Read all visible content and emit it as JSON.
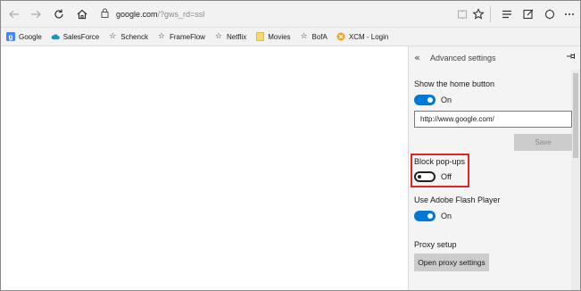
{
  "toolbar": {
    "back_icon": "arrow-left-icon",
    "forward_icon": "arrow-right-icon",
    "refresh_icon": "refresh-icon",
    "home_icon": "home-icon",
    "lock_icon": "lock-icon",
    "address_host": "google.com",
    "address_path": "/?gws_rd=ssl",
    "reading_view_icon": "book-icon",
    "favorite_icon": "star-icon",
    "hub_icon": "hub-icon",
    "note_icon": "pen-note-icon",
    "share_icon": "share-icon",
    "more_icon": "more-icon"
  },
  "favorites": [
    {
      "label": "Google",
      "icon": "google-icon"
    },
    {
      "label": "SalesForce",
      "icon": "cloud-icon"
    },
    {
      "label": "Schenck",
      "icon": "star-outline-icon"
    },
    {
      "label": "FrameFlow",
      "icon": "star-outline-icon"
    },
    {
      "label": "Netflix",
      "icon": "star-outline-icon"
    },
    {
      "label": "Movies",
      "icon": "folder-icon"
    },
    {
      "label": "BofA",
      "icon": "star-outline-icon"
    },
    {
      "label": "XCM - Login",
      "icon": "xcm-icon"
    }
  ],
  "panel": {
    "title": "Advanced settings",
    "back_icon": "double-chevron-left-icon",
    "pin_icon": "pin-icon",
    "home_button": {
      "label": "Show the home button",
      "state": "On",
      "on": true
    },
    "home_url": "http://www.google.com/",
    "save_label": "Save",
    "popups": {
      "label": "Block pop-ups",
      "state": "Off",
      "on": false
    },
    "flash": {
      "label": "Use Adobe Flash Player",
      "state": "On",
      "on": true
    },
    "proxy": {
      "label": "Proxy setup",
      "button_label": "Open proxy settings"
    }
  },
  "colors": {
    "accent": "#0078d7",
    "highlight": "#e52525",
    "panel_bg": "#f4f4f4"
  }
}
